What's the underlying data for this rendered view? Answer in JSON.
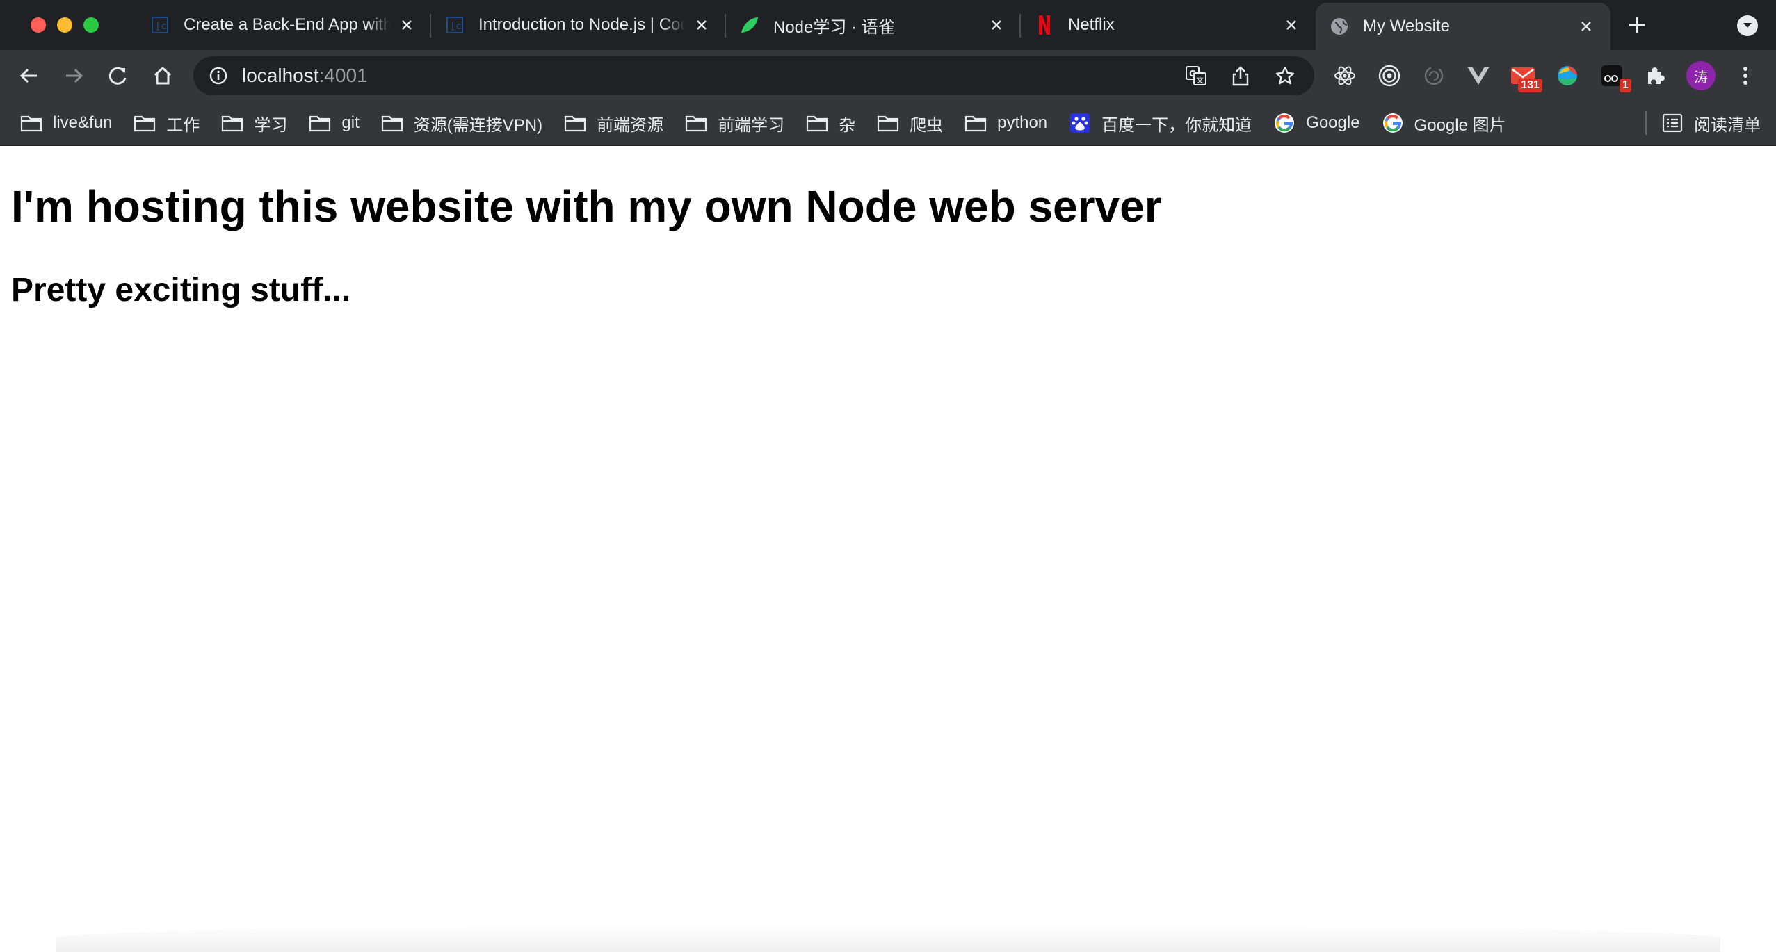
{
  "tabs": [
    {
      "title": "Create a Back-End App with",
      "icon": "codecademy-icon"
    },
    {
      "title": "Introduction to Node.js | Codecademy",
      "icon": "codecademy-icon"
    },
    {
      "title": "Node学习 · 语雀",
      "icon": "yuque-icon"
    },
    {
      "title": "Netflix",
      "icon": "netflix-icon"
    },
    {
      "title": "My Website",
      "icon": "globe-icon",
      "active": true
    }
  ],
  "address": {
    "host": "localhost",
    "port": ":4001"
  },
  "extensions": {
    "mail_badge": "131",
    "ext_badge": "1",
    "avatar_label": "涛"
  },
  "bookmarks": [
    {
      "label": "live&fun",
      "icon": "folder-icon"
    },
    {
      "label": "工作",
      "icon": "folder-icon"
    },
    {
      "label": "学习",
      "icon": "folder-icon"
    },
    {
      "label": "git",
      "icon": "folder-icon"
    },
    {
      "label": "资源(需连接VPN)",
      "icon": "folder-icon"
    },
    {
      "label": "前端资源",
      "icon": "folder-icon"
    },
    {
      "label": "前端学习",
      "icon": "folder-icon"
    },
    {
      "label": "杂",
      "icon": "folder-icon"
    },
    {
      "label": "爬虫",
      "icon": "folder-icon"
    },
    {
      "label": "python",
      "icon": "folder-icon"
    },
    {
      "label": "百度一下，你就知道",
      "icon": "baidu-icon"
    },
    {
      "label": "Google",
      "icon": "google-icon"
    },
    {
      "label": "Google 图片",
      "icon": "google-icon"
    }
  ],
  "reading_list": "阅读清单",
  "page": {
    "heading": "I'm hosting this website with my own Node web server",
    "subheading": "Pretty exciting stuff..."
  },
  "colors": {
    "titlebar": "#202124",
    "toolbar": "#35363a",
    "text": "#e8eaed",
    "badge": "#d93025",
    "avatar": "#8e24aa"
  }
}
